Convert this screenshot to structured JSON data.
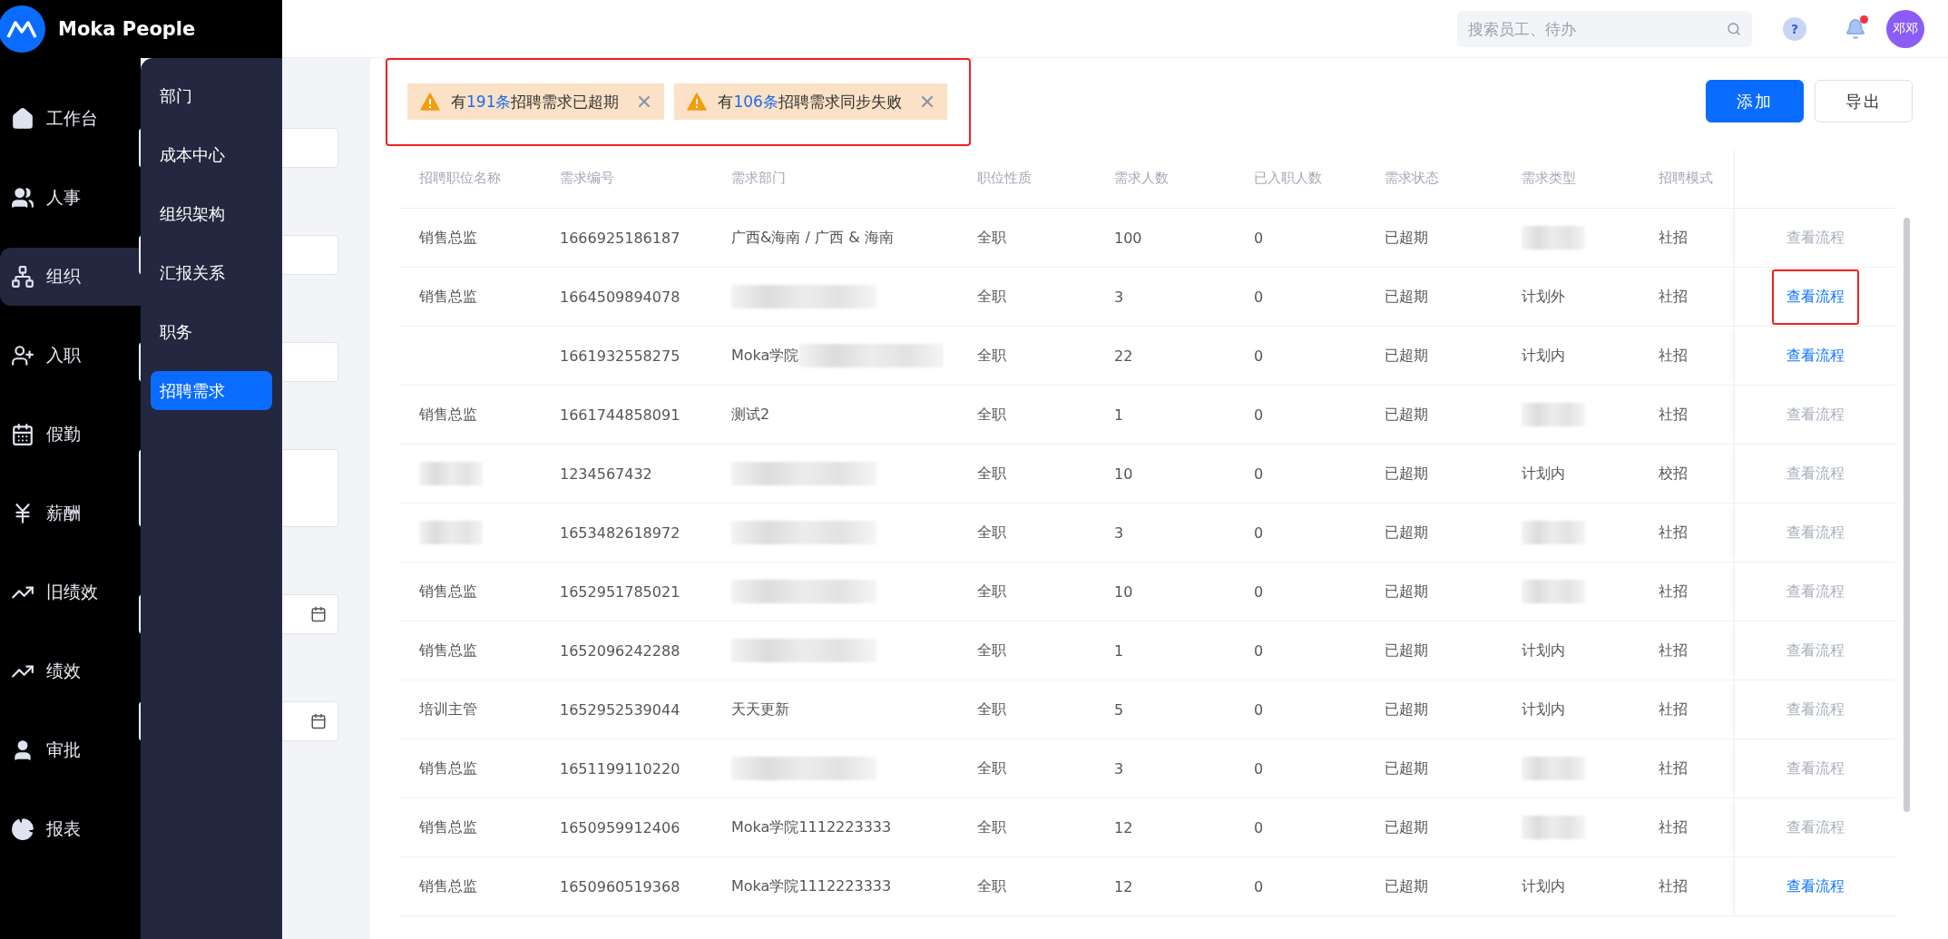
{
  "brand": {
    "name": "Moka People"
  },
  "nav": {
    "items": [
      {
        "label": "工作台",
        "selected": false
      },
      {
        "label": "人事",
        "selected": false
      },
      {
        "label": "组织",
        "selected": true
      },
      {
        "label": "入职",
        "selected": false
      },
      {
        "label": "假勤",
        "selected": false
      },
      {
        "label": "薪酬",
        "selected": false
      },
      {
        "label": "旧绩效",
        "selected": false
      },
      {
        "label": "绩效",
        "selected": false
      },
      {
        "label": "审批",
        "selected": false
      },
      {
        "label": "报表",
        "selected": false
      }
    ]
  },
  "submenu": {
    "items": [
      {
        "label": "部门",
        "selected": false
      },
      {
        "label": "成本中心",
        "selected": false
      },
      {
        "label": "组织架构",
        "selected": false
      },
      {
        "label": "汇报关系",
        "selected": false
      },
      {
        "label": "职务",
        "selected": false
      },
      {
        "label": "招聘需求",
        "selected": true
      }
    ]
  },
  "topbar": {
    "search": {
      "placeholder": "搜索员工、待办"
    },
    "help": {
      "label": "?"
    },
    "notifications": {
      "unread": true
    },
    "avatar": {
      "initials": "邓邓"
    }
  },
  "filters": [
    {
      "kind": "input"
    },
    {
      "kind": "input"
    },
    {
      "kind": "input"
    },
    {
      "kind": "textarea"
    },
    {
      "kind": "date"
    },
    {
      "kind": "date"
    }
  ],
  "alerts": {
    "highlighted": true,
    "items": [
      {
        "prefix": "有",
        "count": "191条",
        "suffix": "招聘需求已超期"
      },
      {
        "prefix": "有",
        "count": "106条",
        "suffix": "招聘需求同步失败"
      }
    ]
  },
  "buttons": [
    {
      "label": "添加",
      "kind": "primary"
    },
    {
      "label": "导出",
      "kind": "default"
    }
  ],
  "table": {
    "columns": [
      "招聘职位名称",
      "需求编号",
      "需求部门",
      "职位性质",
      "需求人数",
      "已入职人数",
      "需求状态",
      "需求类型",
      "招聘模式"
    ],
    "rows": [
      {
        "cells": [
          "销售总监",
          "1666925186187",
          "广西&海南 / 广西 & 海南",
          "全职",
          "100",
          "0",
          "已超期",
          {
            "blurred": true
          },
          "社招"
        ],
        "action": {
          "label": "查看流程",
          "enabled": false,
          "highlighted": false
        }
      },
      {
        "cells": [
          "销售总监",
          "1664509894078",
          {
            "blurred": true
          },
          "全职",
          "3",
          "0",
          "已超期",
          "计划外",
          "社招"
        ],
        "action": {
          "label": "查看流程",
          "enabled": true,
          "highlighted": true
        }
      },
      {
        "cells": [
          null,
          "1661932558275",
          {
            "text": "Moka学院",
            "blurred": true
          },
          "全职",
          "22",
          "0",
          "已超期",
          "计划内",
          "社招"
        ],
        "action": {
          "label": "查看流程",
          "enabled": true,
          "highlighted": false
        }
      },
      {
        "cells": [
          "销售总监",
          "1661744858091",
          "测试2",
          "全职",
          "1",
          "0",
          "已超期",
          {
            "blurred": true
          },
          "社招"
        ],
        "action": {
          "label": "查看流程",
          "enabled": false,
          "highlighted": false
        }
      },
      {
        "cells": [
          {
            "blurred": true
          },
          "1234567432",
          {
            "blurred": true
          },
          "全职",
          "10",
          "0",
          "已超期",
          "计划内",
          "校招"
        ],
        "action": {
          "label": "查看流程",
          "enabled": false,
          "highlighted": false
        }
      },
      {
        "cells": [
          {
            "blurred": true
          },
          "1653482618972",
          {
            "blurred": true
          },
          "全职",
          "3",
          "0",
          "已超期",
          {
            "blurred": true
          },
          "社招"
        ],
        "action": {
          "label": "查看流程",
          "enabled": false,
          "highlighted": false
        }
      },
      {
        "cells": [
          "销售总监",
          "1652951785021",
          {
            "blurred": true
          },
          "全职",
          "10",
          "0",
          "已超期",
          {
            "blurred": true
          },
          "社招"
        ],
        "action": {
          "label": "查看流程",
          "enabled": false,
          "highlighted": false
        }
      },
      {
        "cells": [
          "销售总监",
          "1652096242288",
          {
            "blurred": true
          },
          "全职",
          "1",
          "0",
          "已超期",
          "计划内",
          "社招"
        ],
        "action": {
          "label": "查看流程",
          "enabled": false,
          "highlighted": false
        }
      },
      {
        "cells": [
          "培训主管",
          "1652952539044",
          "天天更新",
          "全职",
          "5",
          "0",
          "已超期",
          "计划内",
          "社招"
        ],
        "action": {
          "label": "查看流程",
          "enabled": false,
          "highlighted": false
        }
      },
      {
        "cells": [
          "销售总监",
          "1651199110220",
          {
            "blurred": true
          },
          "全职",
          "3",
          "0",
          "已超期",
          {
            "blurred": true
          },
          "社招"
        ],
        "action": {
          "label": "查看流程",
          "enabled": false,
          "highlighted": false
        }
      },
      {
        "cells": [
          "销售总监",
          "1650959912406",
          "Moka学院1112223333",
          "全职",
          "12",
          "0",
          "已超期",
          {
            "blurred": true
          },
          "社招"
        ],
        "action": {
          "label": "查看流程",
          "enabled": false,
          "highlighted": false
        }
      },
      {
        "cells": [
          "销售总监",
          "1650960519368",
          "Moka学院1112223333",
          "全职",
          "12",
          "0",
          "已超期",
          "计划内",
          "社招"
        ],
        "action": {
          "label": "查看流程",
          "enabled": true,
          "highlighted": false
        }
      }
    ]
  }
}
